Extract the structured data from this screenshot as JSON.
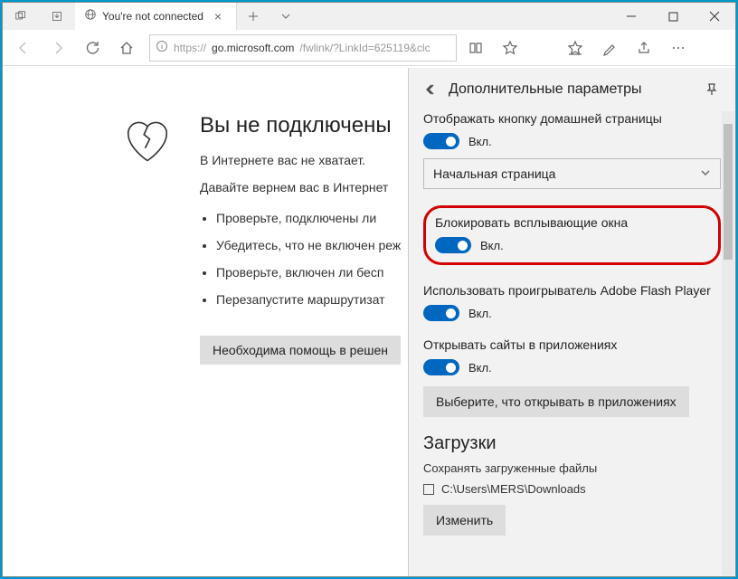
{
  "titlebar": {
    "tab_title": "You're not connected"
  },
  "toolbar": {
    "url_proto": "https://",
    "url_host": "go.microsoft.com",
    "url_path": "/fwlink/?LinkId=625119&clc"
  },
  "error": {
    "title": "Вы не подключены",
    "subtitle": "В Интернете вас не хватает.",
    "text2": "Давайте вернем вас в Интернет",
    "items": [
      "Проверьте, подключены ли",
      "Убедитесь, что не включен реж",
      "Проверьте, включен ли бесп",
      "Перезапустите маршрутизат"
    ],
    "help_button": "Необходима помощь в решен"
  },
  "settings": {
    "header": "Дополнительные параметры",
    "home_button_label": "Отображать кнопку домашней страницы",
    "on_text": "Вкл.",
    "dropdown_value": "Начальная страница",
    "popup_label": "Блокировать всплывающие окна",
    "flash_label": "Использовать проигрыватель Adobe Flash Player",
    "apps_label": "Открывать сайты в приложениях",
    "choose_apps_btn": "Выберите, что открывать в приложениях",
    "downloads_heading": "Загрузки",
    "downloads_sub": "Сохранять загруженные файлы",
    "downloads_path": "C:\\Users\\MERS\\Downloads",
    "change_btn": "Изменить"
  }
}
